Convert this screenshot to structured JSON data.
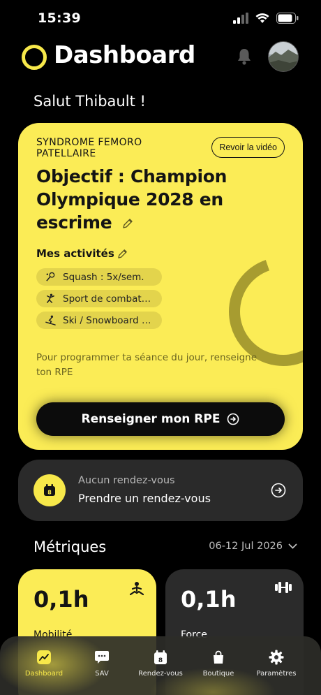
{
  "status": {
    "time": "15:39"
  },
  "header": {
    "title": "Dashboard",
    "bell_icon": "bell-icon",
    "avatar_icon": "avatar"
  },
  "greeting": "Salut Thibault !",
  "goal_card": {
    "syndrome": "SYNDROME FEMORO PATELLAIRE",
    "video_button": "Revoir la vidéo",
    "goal": "Objectif : Champion Olympique 2028 en escrime",
    "activities_title": "Mes activités",
    "activities": [
      {
        "icon": "squash-icon",
        "label": "Squash : 5x/sem."
      },
      {
        "icon": "combat-sport-icon",
        "label": "Sport de combat…"
      },
      {
        "icon": "ski-icon",
        "label": "Ski / Snowboard …"
      }
    ],
    "hint": "Pour programmer ta séance du jour, renseigne ton RPE",
    "rpe_button": "Renseigner mon RPE",
    "accent": "#fbec56"
  },
  "appointment": {
    "empty_label": "Aucun rendez-vous",
    "action_label": "Prendre un rendez-vous"
  },
  "metrics": {
    "title": "Métriques",
    "date_range": "06-12 Jul 2026",
    "cards": [
      {
        "value": "0,1h",
        "label": "Mobilité",
        "icon": "meditation-icon"
      },
      {
        "value": "0,1h",
        "label": "Force",
        "icon": "dumbbell-icon"
      }
    ]
  },
  "tabbar": {
    "tabs": [
      {
        "label": "Dashboard",
        "icon": "chart-icon",
        "active": true
      },
      {
        "label": "SAV",
        "icon": "chat-icon",
        "active": false
      },
      {
        "label": "Rendez-vous",
        "icon": "calendar-icon",
        "active": false
      },
      {
        "label": "Boutique",
        "icon": "bag-icon",
        "active": false
      },
      {
        "label": "Paramètres",
        "icon": "gear-icon",
        "active": false
      }
    ]
  }
}
